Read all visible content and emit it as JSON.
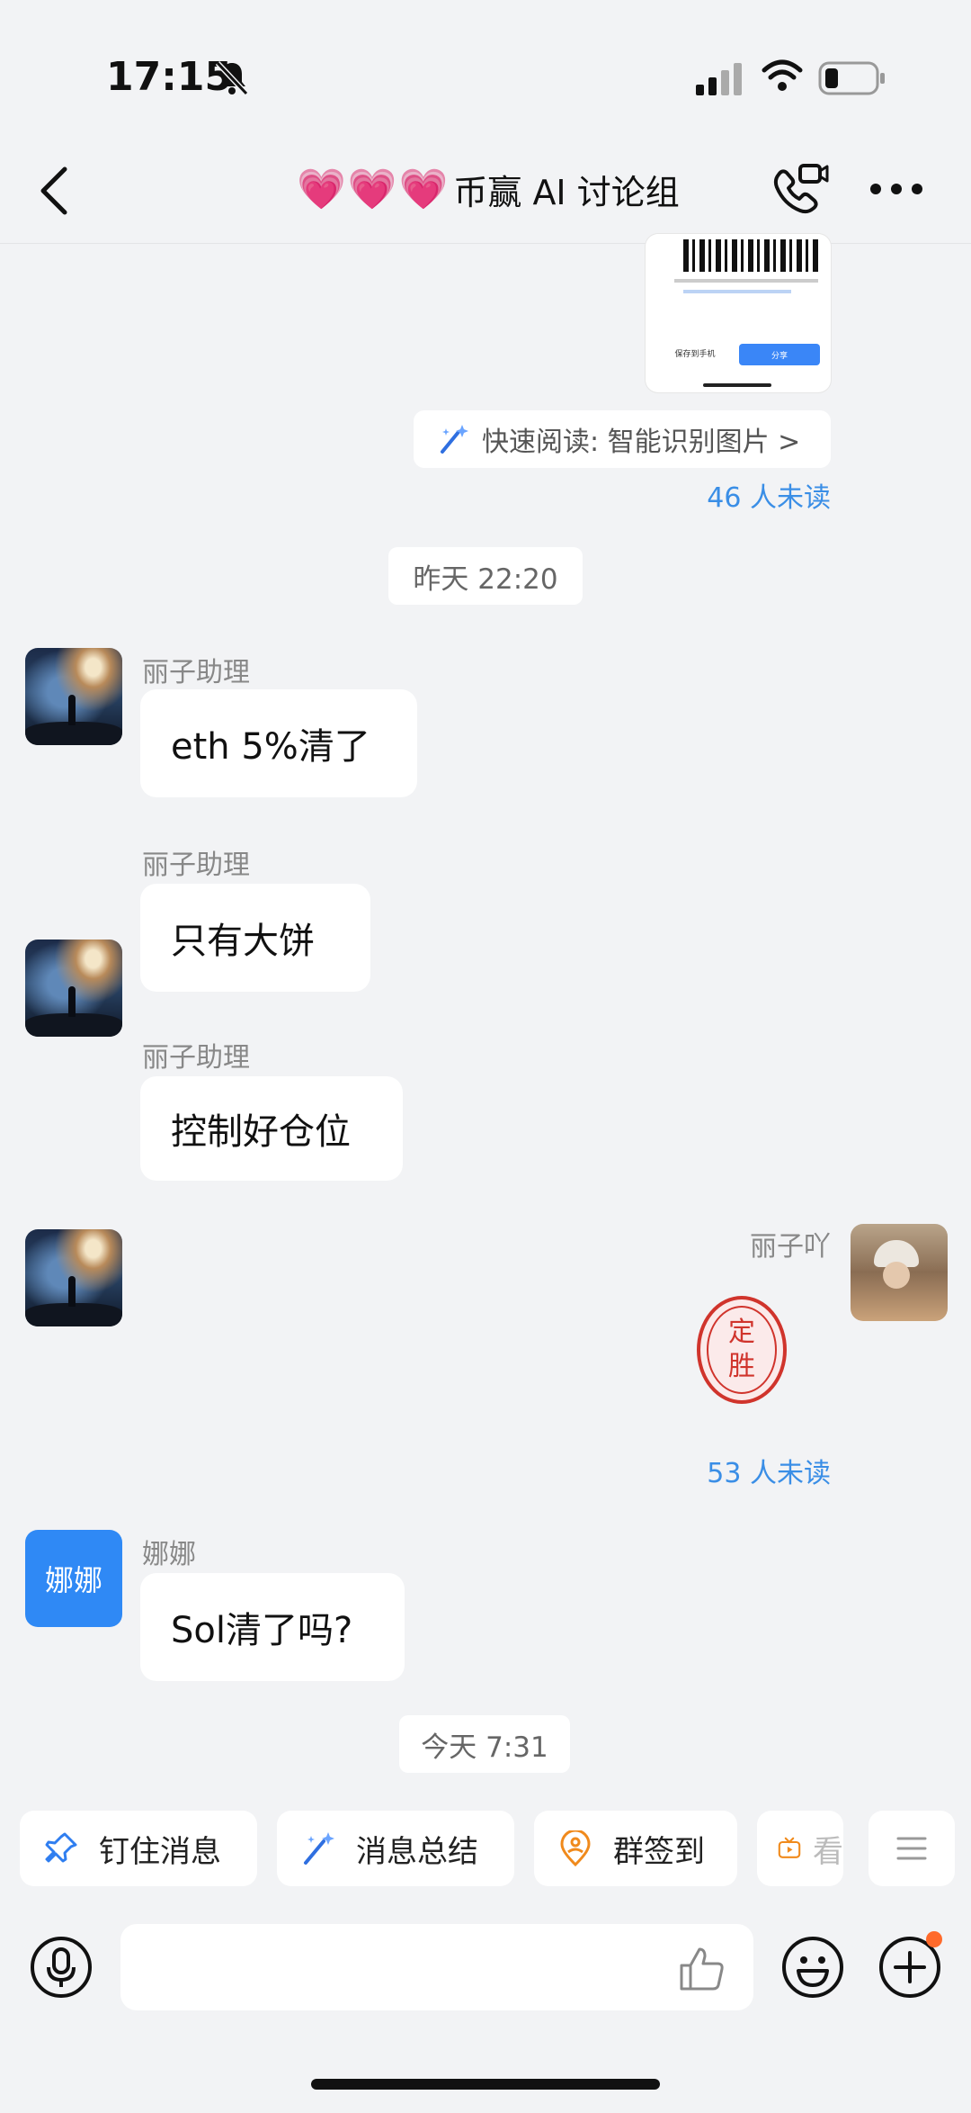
{
  "status_bar": {
    "time": "17:15"
  },
  "header": {
    "hearts": "💗💗💗",
    "title": "币赢 AI 讨论组"
  },
  "qr_card": {
    "save_label": "保存到手机",
    "share_label": "分享"
  },
  "quick_read": {
    "label": "快速阅读: 智能识别图片 >"
  },
  "unread_1": "46 人未读",
  "time_1": "昨天 22:20",
  "messages": [
    {
      "sender": "丽子助理",
      "text": "eth 5%清了"
    },
    {
      "sender": "丽子助理",
      "text": "只有大饼"
    },
    {
      "sender": "丽子助理",
      "text": "控制好仓位"
    }
  ],
  "self_message": {
    "sender": "丽子吖",
    "stamp_text": "定胜"
  },
  "unread_2": "53 人未读",
  "nana": {
    "avatar_text": "娜娜",
    "sender": "娜娜",
    "text": "Sol清了吗?"
  },
  "time_2": "今天 7:31",
  "quick_actions": [
    {
      "label": "钉住消息",
      "icon": "pin-icon"
    },
    {
      "label": "消息总结",
      "icon": "magic-wand-icon"
    },
    {
      "label": "群签到",
      "icon": "location-person-icon"
    },
    {
      "label": "看",
      "icon": "tv-icon"
    }
  ],
  "colors": {
    "accent": "#3a8ee6",
    "unread": "#3a8ee6",
    "stamp": "#d0342c",
    "nana_avatar": "#2f89f5",
    "hearts": "#ff3aa8"
  }
}
